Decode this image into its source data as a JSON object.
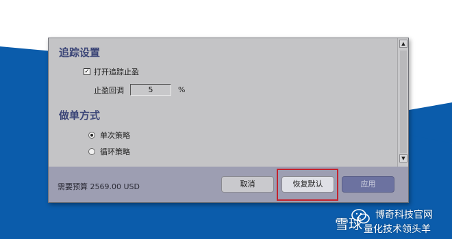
{
  "dialog": {
    "tracking_section": {
      "title": "追踪设置",
      "enable_checkbox": {
        "label": "打开追踪止盈",
        "checked": true
      },
      "pullback": {
        "label": "止盈回调",
        "value": "5",
        "unit": "%"
      }
    },
    "order_section": {
      "title": "做单方式",
      "options": [
        {
          "label": "单次策略",
          "selected": true
        },
        {
          "label": "循环策略",
          "selected": false
        }
      ]
    },
    "scrollbar": {
      "up_icon": "scroll-up-arrow",
      "down_icon": "scroll-down-arrow"
    },
    "footer": {
      "budget_text": "需要预算 2569.00 USD",
      "buttons": {
        "cancel": "取消",
        "restore": "恢复默认",
        "apply": "应用"
      }
    }
  },
  "watermark": {
    "brand": "雪球",
    "name": "博奇科技官网",
    "sub": "量化技术领头羊"
  },
  "colors": {
    "dialog_bg": "#c4c4c6",
    "footer_bg": "#9d9eb2",
    "section_title": "#3b4577",
    "apply_button": "#6c72a0",
    "highlight": "#c4222c",
    "background_blue": "#0b5cab"
  }
}
